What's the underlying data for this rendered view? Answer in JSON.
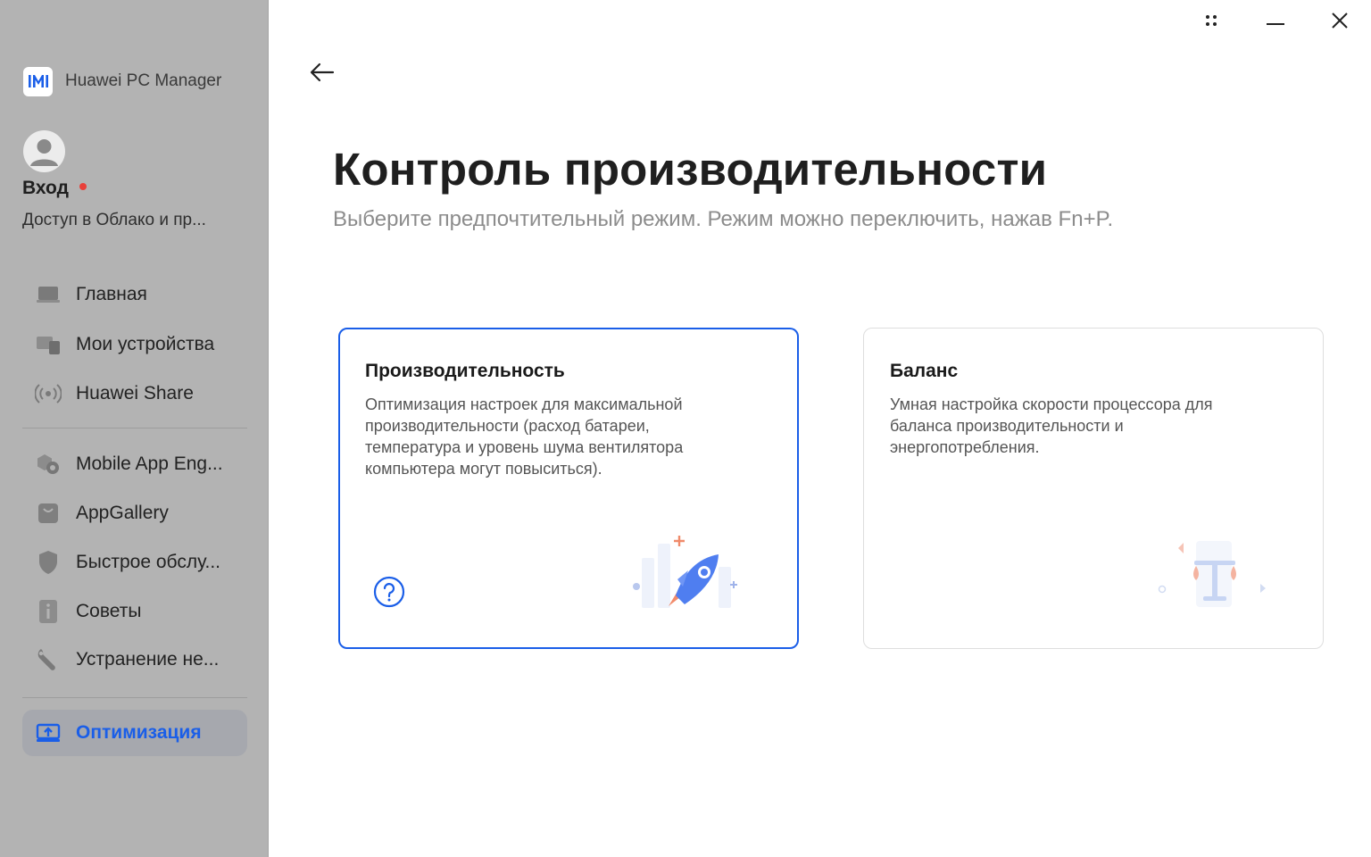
{
  "app": {
    "name": "Huawei PC Manager"
  },
  "account": {
    "login_label": "Вход",
    "subtitle": "Доступ в Облако и пр..."
  },
  "sidebar": {
    "items": [
      {
        "label": "Главная",
        "icon": "laptop-icon"
      },
      {
        "label": "Мои устройства",
        "icon": "devices-icon"
      },
      {
        "label": "Huawei Share",
        "icon": "wireless-share-icon"
      },
      {
        "label": "Mobile App Eng...",
        "icon": "app-engine-icon"
      },
      {
        "label": "AppGallery",
        "icon": "shopping-bag-icon"
      },
      {
        "label": "Быстрое обслу...",
        "icon": "shield-icon"
      },
      {
        "label": "Советы",
        "icon": "info-book-icon"
      },
      {
        "label": "Устранение не...",
        "icon": "wrench-icon"
      },
      {
        "label": "Оптимизация",
        "icon": "optimize-icon",
        "active": true
      }
    ]
  },
  "window_controls": [
    "more-icon",
    "minimize-icon",
    "close-icon"
  ],
  "main": {
    "title": "Контроль производительности",
    "subtitle": "Выберите предпочтительный режим. Режим можно переключить, нажав Fn+P.",
    "modes": [
      {
        "title": "Производительность",
        "description": "Оптимизация настроек для максимальной производительности (расход батареи, температура и уровень шума вентилятора компьютера могут повыситься).",
        "selected": true,
        "illustration": "rocket-icon"
      },
      {
        "title": "Баланс",
        "description": "Умная настройка скорости процессора для баланса производительности и энергопотребления.",
        "selected": false,
        "illustration": "balance-scale-icon"
      }
    ]
  },
  "colors": {
    "accent": "#1a5ee8",
    "sidebar_bg": "#b3b3b3",
    "active_item_bg": "#a6a8ae"
  }
}
